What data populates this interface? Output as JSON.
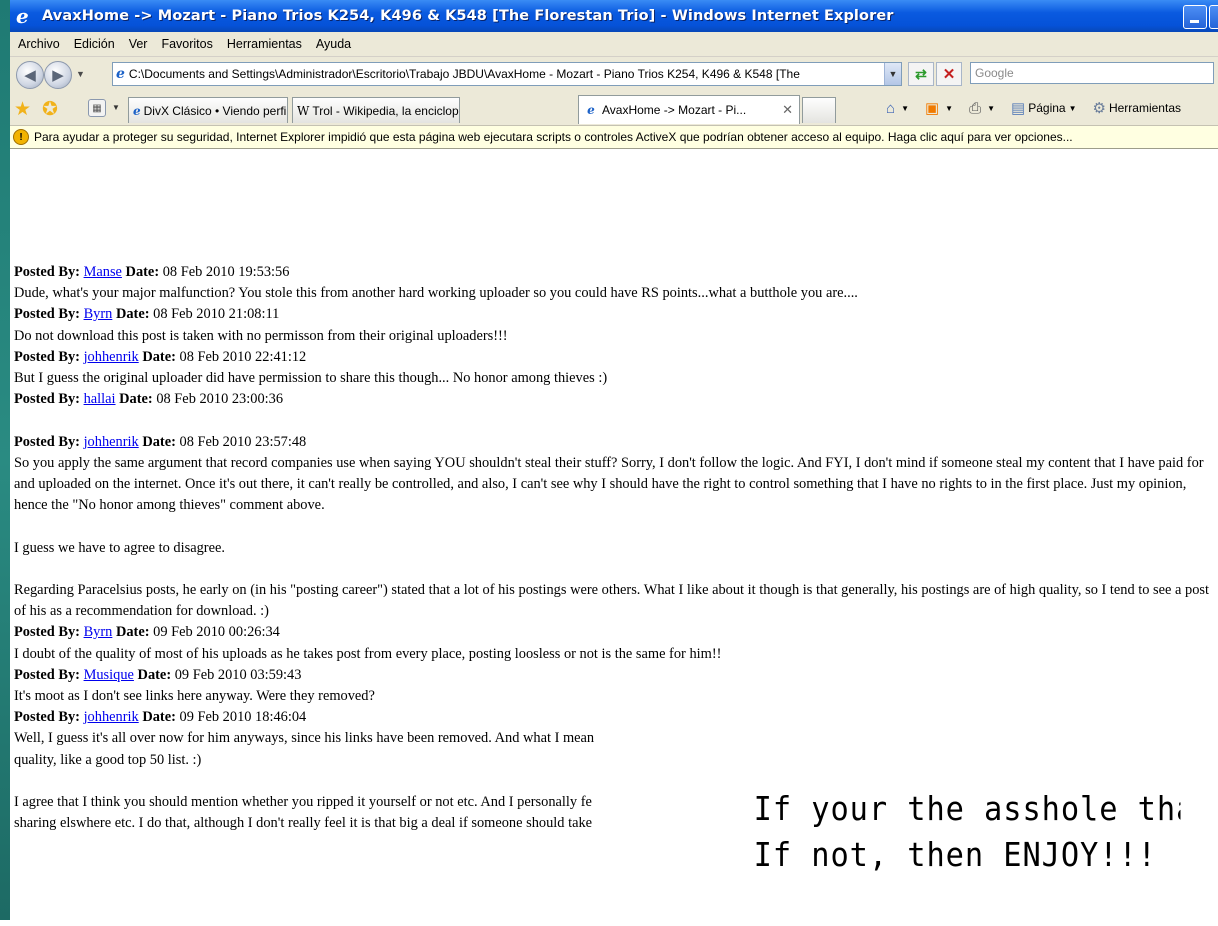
{
  "window": {
    "title": "AvaxHome -> Mozart - Piano Trios K254, K496 & K548 [The Florestan Trio] - Windows Internet Explorer"
  },
  "menu": [
    "Archivo",
    "Edición",
    "Ver",
    "Favoritos",
    "Herramientas",
    "Ayuda"
  ],
  "address": {
    "url": "C:\\Documents and Settings\\Administrador\\Escritorio\\Trabajo JBDU\\AvaxHome - Mozart - Piano Trios K254, K496 & K548 [The",
    "search_placeholder": "Google"
  },
  "tabs": [
    {
      "label": "DivX Clásico • Viendo perfil - ...",
      "icon": "ie-page-icon"
    },
    {
      "label": "Trol - Wikipedia, la enciclope...",
      "icon": "wikipedia-icon"
    },
    {
      "label": "AvaxHome -> Mozart - Pi...",
      "icon": "ie-page-icon",
      "active": true
    },
    {
      "label": "",
      "icon": "new-tab"
    }
  ],
  "command_bar": {
    "page": "Página",
    "tools": "Herramientas"
  },
  "infobar": {
    "text": "Para ayudar a proteger su seguridad, Internet Explorer impidió que esta página web ejecutara scripts o controles ActiveX que podrían obtener acceso al equipo. Haga clic aquí para ver opciones..."
  },
  "labels": {
    "posted_by": "Posted By:",
    "date": "Date:"
  },
  "posts": [
    {
      "user": "Manse",
      "date": "08 Feb 2010 19:53:56",
      "body": [
        "Dude, what's your major malfunction? You stole this from another hard working uploader so you could have RS points...what a butthole you are...."
      ]
    },
    {
      "user": "Byrn",
      "date": "08 Feb 2010 21:08:11",
      "body": [
        "Do not download this post is taken with no permisson from their original uploaders!!!"
      ]
    },
    {
      "user": "johhenrik",
      "date": "08 Feb 2010 22:41:12",
      "body": [
        "But I guess the original uploader did have permission to share this though... No honor among thieves :)"
      ]
    },
    {
      "user": "hallai",
      "date": "08 Feb 2010 23:00:36",
      "body": []
    },
    {
      "user": "johhenrik",
      "date": "08 Feb 2010 23:57:48",
      "body": [
        "So you apply the same argument that record companies use when saying YOU shouldn't steal their stuff? Sorry, I don't follow the logic. And FYI, I don't mind if someone steal my content that I have paid for and uploaded on the internet. Once it's out there, it can't really be controlled, and also, I can't see why I should have the right to control something that I have no rights to in the first place. Just my opinion, hence the \"No honor among thieves\" comment above.",
        "I guess we have to agree to disagree.",
        "Regarding Paracelsius posts, he early on (in his \"posting career\") stated that a lot of his postings were others. What I like about it though is that generally, his postings are of high quality, so I tend to see a post of his as a recommendation for download. :)"
      ]
    },
    {
      "user": "Byrn",
      "date": "09 Feb 2010 00:26:34",
      "body": [
        "I doubt of the quality of most of his uploads as he takes post from every place, posting loosless or not is the same for him!!"
      ]
    },
    {
      "user": "Musique",
      "date": "09 Feb 2010 03:59:43",
      "body": [
        "It's moot as I don't see links here anyway. Were they removed?"
      ]
    },
    {
      "user": "johhenrik",
      "date": "09 Feb 2010 18:46:04",
      "body": [
        "Well, I guess it's all over now for him anyways, since his links have been removed. And what I mean",
        "quality, like a good top 50 list. :)",
        "I agree that I think you should mention whether you ripped it yourself or not etc. And I personally fe",
        "sharing elswhere etc. I do that, although I don't really feel it is that big a deal if someone should take"
      ]
    }
  ],
  "overlay": {
    "line1": "If your the asshole that's de",
    "line2": "If not, then ENJOY!!!"
  }
}
